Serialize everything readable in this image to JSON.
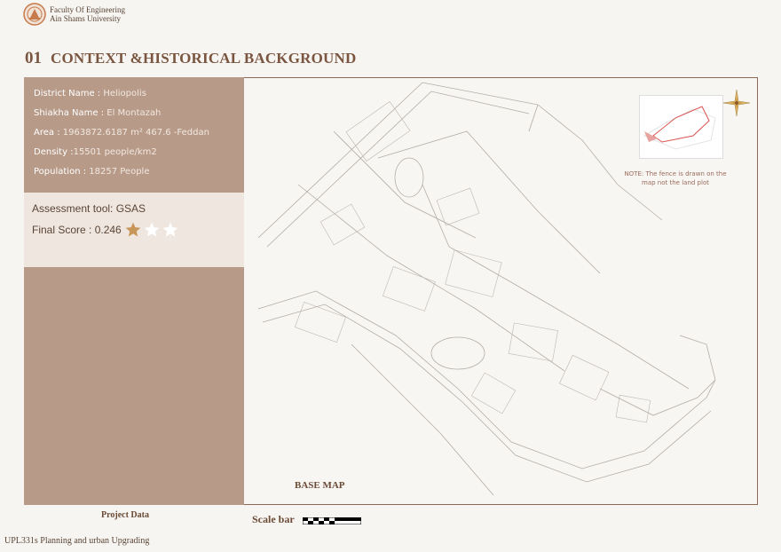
{
  "header": {
    "line1": "Faculty Of Engineering",
    "line2": "Ain Shams University"
  },
  "section": {
    "number": "01",
    "title": "CONTEXT &HISTORICAL BACKGROUND"
  },
  "info": {
    "district_label": "District Name : ",
    "district_value": "Heliopolis",
    "shiakha_label": "Shiakha Name : ",
    "shiakha_value": "El Montazah",
    "area_label": "Area : ",
    "area_value": "1963872.6187 m² 467.6 -Feddan",
    "density_label": "Density :",
    "density_value": "15501  people/km2",
    "population_label": "Population : ",
    "population_value": "18257  People"
  },
  "assessment": {
    "tool": "Assessment tool: GSAS",
    "score_label": "Final Score : 0.246",
    "stars_total": 3,
    "stars_filled": 1,
    "star_filled_color": "#c9965a",
    "star_empty_color": "#ffffff"
  },
  "map": {
    "label": "BASE MAP",
    "note": "NOTE: The fence is drawn on the map not the land plot"
  },
  "captions": {
    "project_data": "Project Data",
    "scale_bar": "Scale bar"
  },
  "footer": "UPL331s Planning and urban Upgrading",
  "colors": {
    "accent": "#7a5640",
    "panel": "#b79a88",
    "assessment_bg": "#efe6df"
  }
}
